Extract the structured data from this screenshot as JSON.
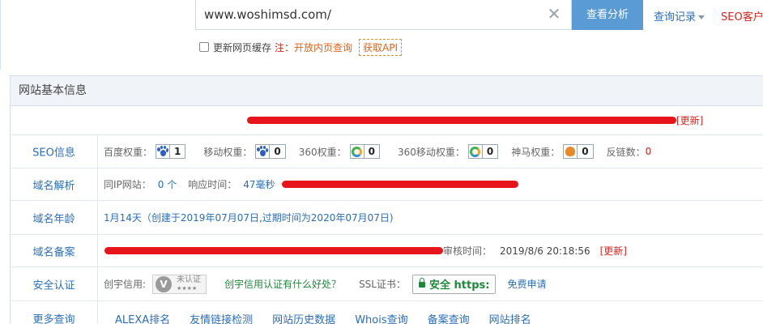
{
  "search": {
    "value": "www.woshimsd.com/",
    "clear_icon": "close-icon",
    "analyze_label": "查看分析",
    "history_label": "查询记录",
    "seo_client_label": "SEO客户"
  },
  "options": {
    "cache_label": "更新网页缓存",
    "note_prefix": "注：",
    "note_link": "开放内页查询",
    "api_label": "获取API"
  },
  "panel": {
    "title": "网站基本信息",
    "update_label": "[更新]",
    "seo": {
      "title": "SEO信息",
      "baidu_label": "百度权重：",
      "baidu_value": "1",
      "mobile_label": "移动权重：",
      "mobile_value": "0",
      "s360_label": "360权重：",
      "s360_value": "0",
      "s360m_label": "360移动权重：",
      "s360m_value": "0",
      "shenma_label": "神马权重：",
      "shenma_value": "0",
      "backlinks_label": "反链数：",
      "backlinks_value": "0"
    },
    "dns": {
      "title": "域名解析",
      "same_ip_label": "同IP网站：",
      "same_ip_value": "0 个",
      "response_label": "响应时间：",
      "response_value": "47毫秒"
    },
    "age": {
      "title": "域名年龄",
      "value": "1月14天（创建于2019年07月07日,过期时间为2020年07月07日)"
    },
    "icp": {
      "title": "域名备案",
      "audit_label": "审核时间：",
      "audit_value": "2019/8/6 20:18:56",
      "update_label": "[更新]"
    },
    "cert": {
      "title": "安全认证",
      "credit_label": "创宇信用:",
      "credit_badge_letter": "V",
      "credit_badge_text": "未认证",
      "credit_badge_stars": "★★★★",
      "credit_link": "创宇信用认证有什么好处？",
      "ssl_label": "SSL证书：",
      "ssl_badge": "安全 https:",
      "ssl_apply": "免费申请"
    },
    "more": {
      "title": "更多查询",
      "links": [
        "ALEXA排名",
        "友情链接检测",
        "网站历史数据",
        "Whois查询",
        "备案查询",
        "网站排名"
      ]
    }
  },
  "colors": {
    "accent": "#5b9bd5",
    "link": "#2a6ebb",
    "alert": "#d9251c",
    "redaction": "#e8141c"
  }
}
